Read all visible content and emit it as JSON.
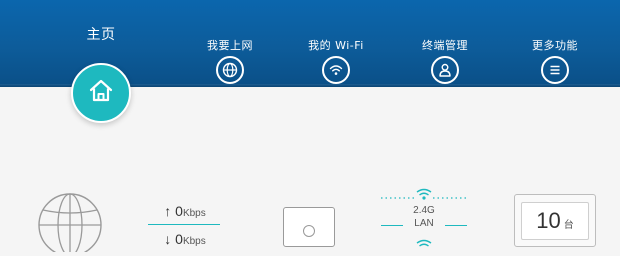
{
  "nav": {
    "home": {
      "label": "主页",
      "icon": "home-icon"
    },
    "items": [
      {
        "label": "我要上网",
        "icon": "globe-icon"
      },
      {
        "label": "我的 Wi-Fi",
        "icon": "wifi-icon"
      },
      {
        "label": "终端管理",
        "icon": "user-icon"
      },
      {
        "label": "更多功能",
        "icon": "menu-icon"
      }
    ]
  },
  "colors": {
    "header": "#0d5c9a",
    "accent": "#1eb9bf"
  },
  "status": {
    "upload": {
      "value": "0",
      "unit": "Kbps"
    },
    "download": {
      "value": "0",
      "unit": "Kbps"
    },
    "band": "2.4G",
    "link": "LAN",
    "devices": {
      "count": "10",
      "unit": "台"
    }
  }
}
